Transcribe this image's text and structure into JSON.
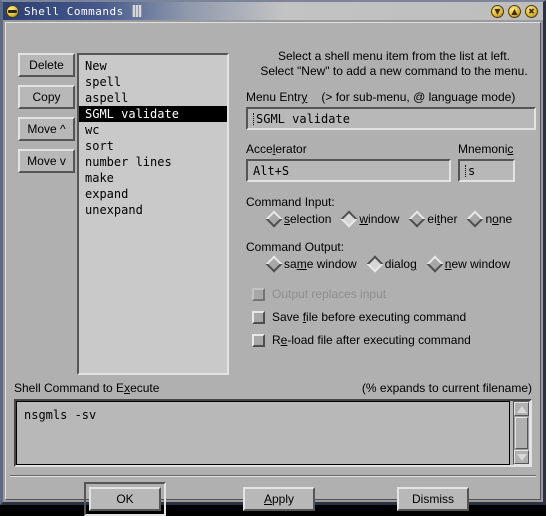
{
  "window": {
    "title": "Shell Commands",
    "icon": "app-icon",
    "controls": [
      {
        "name": "minimize-button",
        "glyph": "▼"
      },
      {
        "name": "maximize-button",
        "glyph": "▲"
      },
      {
        "name": "close-button",
        "glyph": "✖"
      }
    ]
  },
  "side_buttons": [
    {
      "label": "Delete"
    },
    {
      "label": "Copy"
    },
    {
      "label": "Move ^"
    },
    {
      "label": "Move v"
    }
  ],
  "command_list": {
    "items": [
      {
        "label": "New",
        "selected": false
      },
      {
        "label": "spell",
        "selected": false
      },
      {
        "label": "aspell",
        "selected": false
      },
      {
        "label": "SGML validate",
        "selected": true
      },
      {
        "label": "wc",
        "selected": false
      },
      {
        "label": "sort",
        "selected": false
      },
      {
        "label": "number lines",
        "selected": false
      },
      {
        "label": "make",
        "selected": false
      },
      {
        "label": "expand",
        "selected": false
      },
      {
        "label": "unexpand",
        "selected": false
      }
    ]
  },
  "instructions": {
    "line1": "Select a shell menu item from the list at left.",
    "line2": "Select \"New\" to add a new command to the menu."
  },
  "menu_entry": {
    "label": "Menu Entr",
    "label_mnemonic": "y",
    "hint": "(> for sub-menu, @ language mode)",
    "value": "SGML validate"
  },
  "accelerator": {
    "label_pre": "Acce",
    "label_mnemonic": "l",
    "label_post": "erator",
    "value": "Alt+S"
  },
  "mnemonic": {
    "label_pre": "Mnemoni",
    "label_mnemonic": "c",
    "label_post": "",
    "value": "s"
  },
  "command_input": {
    "label": "Command Input:",
    "options": [
      {
        "pre": "",
        "mnemonic": "s",
        "post": "election",
        "selected": false
      },
      {
        "pre": "",
        "mnemonic": "w",
        "post": "indow",
        "selected": true
      },
      {
        "pre": "ei",
        "mnemonic": "t",
        "post": "her",
        "selected": false
      },
      {
        "pre": "n",
        "mnemonic": "o",
        "post": "ne",
        "selected": false
      }
    ]
  },
  "command_output": {
    "label": "Command Output:",
    "options": [
      {
        "pre": "sa",
        "mnemonic": "m",
        "post": "e window",
        "selected": false
      },
      {
        "pre": "dialo",
        "mnemonic": "g",
        "post": "",
        "selected": true
      },
      {
        "pre": "",
        "mnemonic": "n",
        "post": "ew window",
        "selected": false
      }
    ]
  },
  "checkboxes": [
    {
      "pre": "Output replaces input",
      "mnemonic": "",
      "post": "",
      "checked": false,
      "disabled": true
    },
    {
      "pre": "Save ",
      "mnemonic": "f",
      "post": "ile before executing command",
      "checked": false,
      "disabled": false
    },
    {
      "pre": "R",
      "mnemonic": "e",
      "post": "-load file after executing command",
      "checked": false,
      "disabled": false
    }
  ],
  "shell_command": {
    "label_pre": "Shell Command to E",
    "label_mnemonic": "x",
    "label_post": "ecute",
    "hint": "(% expands to current filename)",
    "value": "nsgmls -sv"
  },
  "bottom_buttons": [
    {
      "pre": "OK",
      "mnemonic": "",
      "post": "",
      "default": true
    },
    {
      "pre": "",
      "mnemonic": "A",
      "post": "pply",
      "default": false
    },
    {
      "pre": "Dismiss",
      "mnemonic": "",
      "post": "",
      "default": false
    }
  ],
  "colors": {
    "face": "#b0b0b0",
    "field": "#b8b8b8",
    "list": "#c9c9c9",
    "selection_bg": "#000000",
    "selection_fg": "#ffffff",
    "title_accent": "#2c3f72"
  }
}
